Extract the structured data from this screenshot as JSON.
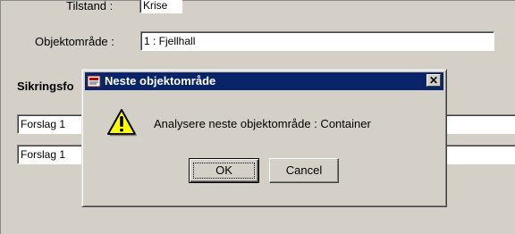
{
  "form": {
    "tilstand_label": "Tilstand :",
    "tilstand_value": "Krise",
    "objektomrade_label": "Objektområde :",
    "objektomrade_value": "1 : Fjellhall",
    "section_label": "Sikringsfo",
    "forslag1_value": "Forslag 1",
    "forslag2_value": "Forslag 1"
  },
  "dialog": {
    "title": "Neste objektområde",
    "close_glyph": "✕",
    "message": "Analysere neste objektområde : Container",
    "ok_label": "OK",
    "cancel_label": "Cancel"
  },
  "icons": {
    "title_icon": "app-icon",
    "message_icon": "warning-icon"
  },
  "colors": {
    "titlebar": "#0a246a",
    "face": "#d4d0c8",
    "warning": "#ffff00"
  }
}
